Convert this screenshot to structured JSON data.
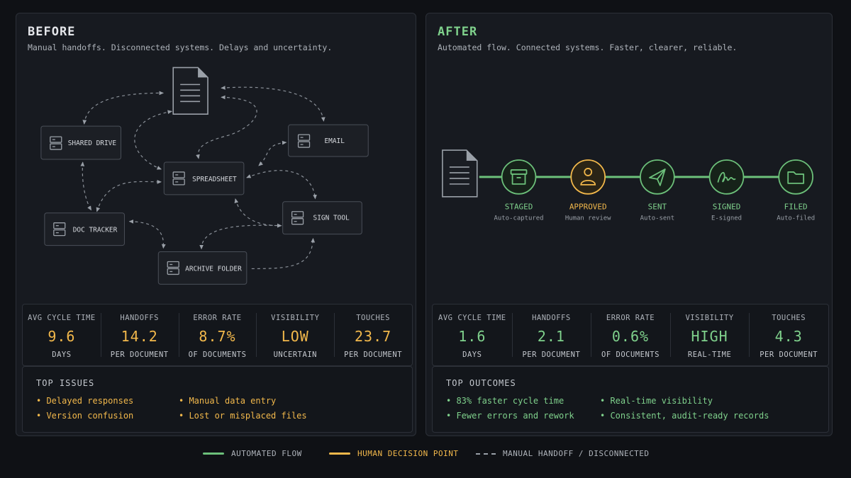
{
  "before": {
    "title": "BEFORE",
    "subtitle": "Manual handoffs. Disconnected systems. Delays and uncertainty.",
    "nodes": [
      "SHARED DRIVE",
      "EMAIL",
      "SPREADSHEET",
      "SIGN TOOL",
      "DOC TRACKER",
      "ARCHIVE FOLDER"
    ],
    "metrics": [
      {
        "label": "AVG CYCLE TIME",
        "value": "9.6",
        "unit": "DAYS"
      },
      {
        "label": "HANDOFFS",
        "value": "14.2",
        "unit": "PER DOCUMENT"
      },
      {
        "label": "ERROR RATE",
        "value": "8.7%",
        "unit": "OF DOCUMENTS"
      },
      {
        "label": "VISIBILITY",
        "value": "LOW",
        "unit": "UNCERTAIN"
      },
      {
        "label": "TOUCHES",
        "value": "23.7",
        "unit": "PER DOCUMENT"
      }
    ],
    "list_title": "TOP ISSUES",
    "items": [
      "• Delayed responses",
      "• Manual data entry",
      "• Version confusion",
      "• Lost or misplaced files"
    ]
  },
  "after": {
    "title": "AFTER",
    "subtitle": "Automated flow. Connected systems. Faster, clearer, reliable.",
    "steps": [
      {
        "label": "STAGED",
        "sub": "Auto-captured",
        "icon": "archive-box-icon",
        "kind": "automated"
      },
      {
        "label": "APPROVED",
        "sub": "Human review",
        "icon": "person-icon",
        "kind": "human"
      },
      {
        "label": "SENT",
        "sub": "Auto-sent",
        "icon": "paper-plane-icon",
        "kind": "automated"
      },
      {
        "label": "SIGNED",
        "sub": "E-signed",
        "icon": "signature-icon",
        "kind": "automated"
      },
      {
        "label": "FILED",
        "sub": "Auto-filed",
        "icon": "folder-icon",
        "kind": "automated"
      }
    ],
    "metrics": [
      {
        "label": "AVG CYCLE TIME",
        "value": "1.6",
        "unit": "DAYS"
      },
      {
        "label": "HANDOFFS",
        "value": "2.1",
        "unit": "PER DOCUMENT"
      },
      {
        "label": "ERROR RATE",
        "value": "0.6%",
        "unit": "OF DOCUMENTS"
      },
      {
        "label": "VISIBILITY",
        "value": "HIGH",
        "unit": "REAL-TIME"
      },
      {
        "label": "TOUCHES",
        "value": "4.3",
        "unit": "PER DOCUMENT"
      }
    ],
    "list_title": "TOP OUTCOMES",
    "items": [
      "• 83% faster cycle time",
      "• Real-time visibility",
      "• Fewer errors and rework",
      "• Consistent, audit-ready records"
    ]
  },
  "legend": {
    "automated": "AUTOMATED FLOW",
    "human": "HUMAN DECISION POINT",
    "manual": "MANUAL HANDOFF / DISCONNECTED"
  },
  "colors": {
    "automated": "#6cc07a",
    "human": "#f2b84b",
    "manual": "#9aa0a8"
  }
}
